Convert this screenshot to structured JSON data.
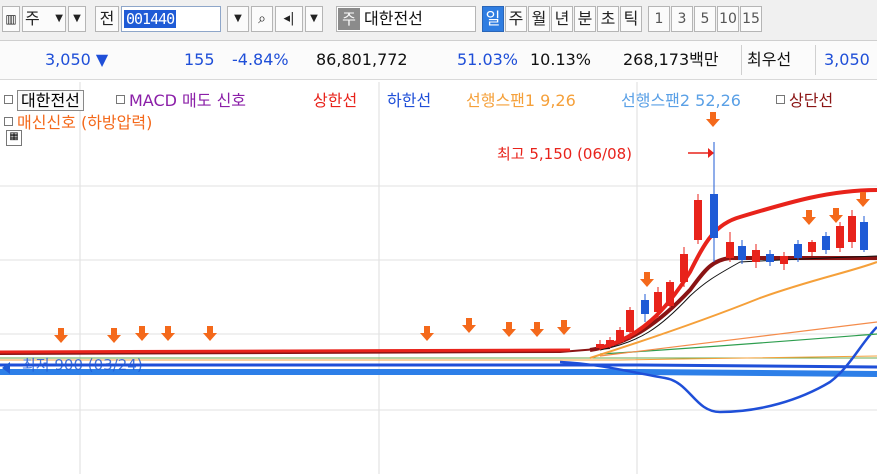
{
  "toolbar": {
    "market_tab": "주",
    "prev_label": "전",
    "code": "001440",
    "stock_tag": "주",
    "stock_name": "대한전선",
    "periods": [
      "일",
      "주",
      "월",
      "년",
      "분",
      "초",
      "틱"
    ],
    "selected_period": "일",
    "intervals": [
      "1",
      "3",
      "5",
      "10",
      "15"
    ]
  },
  "quote": {
    "price": "3,050",
    "change": "155",
    "change_pct": "-4.84%",
    "volume": "86,801,772",
    "rate1": "51.03%",
    "rate2": "10.13%",
    "amount": "268,173백만",
    "best_label": "최우선",
    "best_price": "3,050"
  },
  "legend": {
    "stock": "대한전선",
    "macd_sell": "MACD 매도 신호",
    "upper": "상한선",
    "lower": "하한선",
    "span1": "선행스팬1 9,26",
    "span2": "선행스팬2 52,26",
    "top": "상단선",
    "signal": "매신신호 (하방압력)"
  },
  "annotations": {
    "high": "최고 5,150 (06/08)",
    "low": "최저 900 (03/24)"
  },
  "colors": {
    "up": "#e8231b",
    "down": "#1f5bd6",
    "macd": "#8b1fa8",
    "upper": "#e8231b",
    "lower": "#1f4fd8",
    "span1": "#f5a03a",
    "span2": "#5aa0e6",
    "top": "#8a1414",
    "arrow": "#f4691b"
  },
  "chart_data": {
    "type": "candlestick",
    "series": [
      {
        "name": "대한전선"
      },
      {
        "name": "상한선"
      },
      {
        "name": "하한선"
      },
      {
        "name": "선행스팬1 9,26"
      },
      {
        "name": "선행스팬2 52,26"
      },
      {
        "name": "상단선"
      }
    ],
    "high": {
      "value": 5150,
      "date": "06/08"
    },
    "low": {
      "value": 900,
      "date": "03/24"
    },
    "current": 3050
  }
}
